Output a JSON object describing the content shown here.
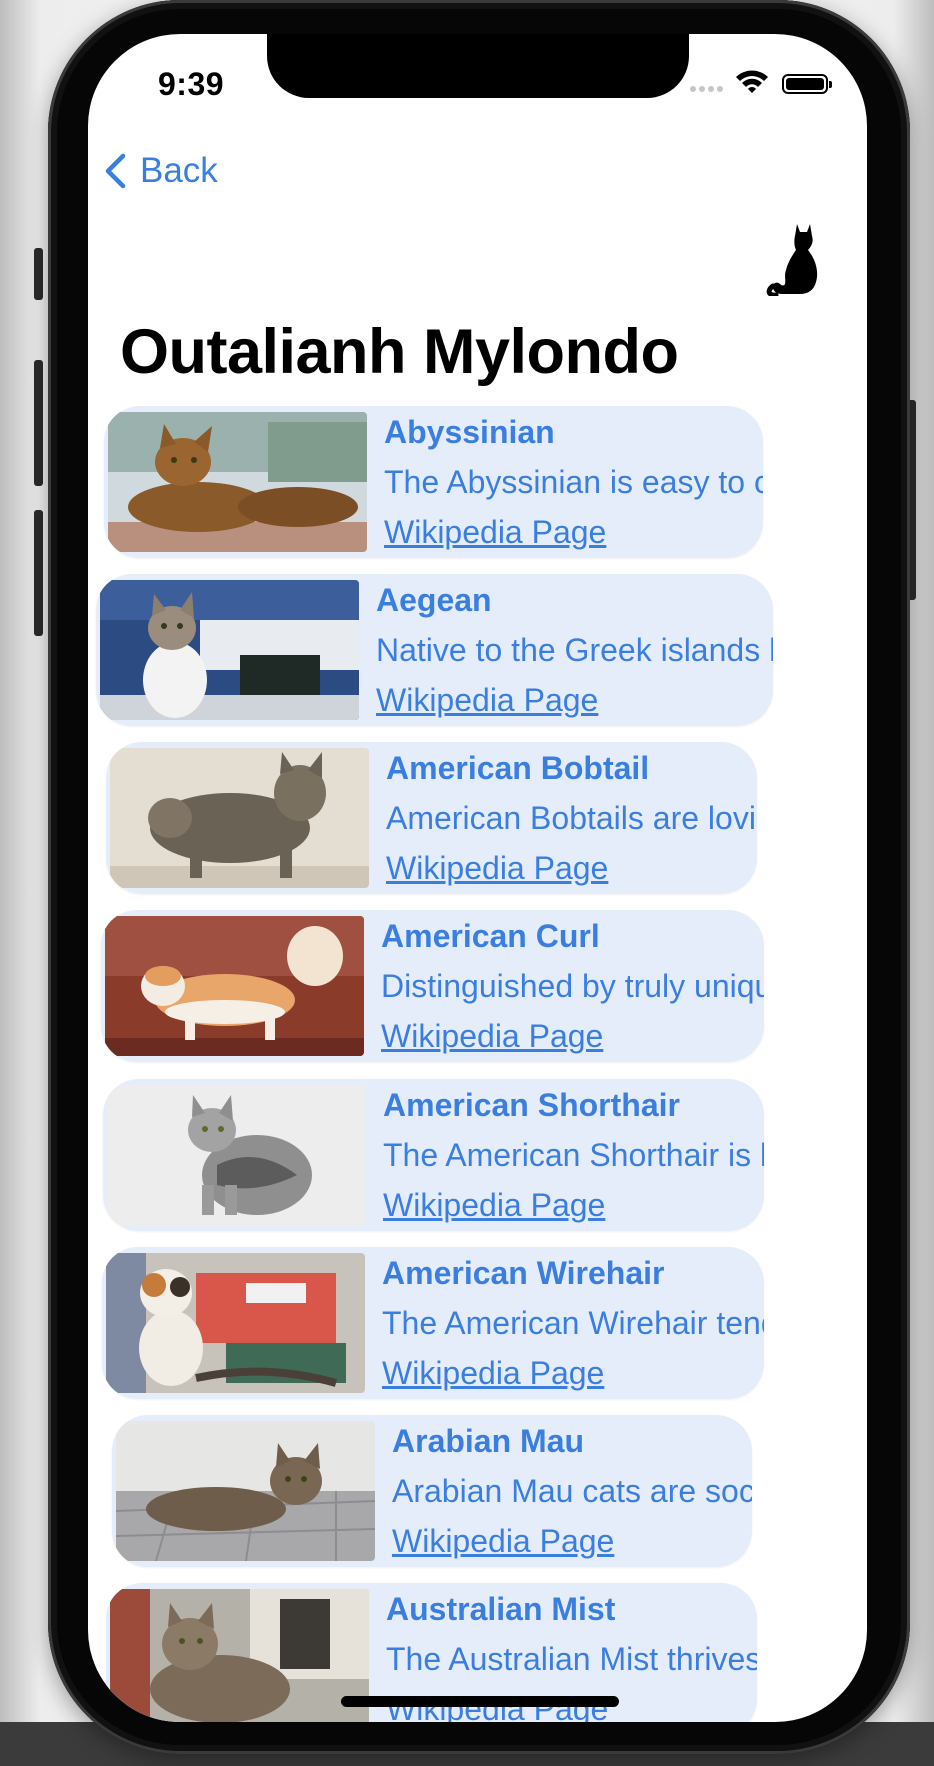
{
  "status_bar": {
    "time": "9:39"
  },
  "nav": {
    "back_label": "Back"
  },
  "page": {
    "title": "Outalianh Mylondo"
  },
  "accent_color": "#3a7ee0",
  "card_color": "#e6edfa",
  "breeds": [
    {
      "name": "Abyssinian",
      "description": "The Abyssinian is easy to car...",
      "link": "Wikipedia Page",
      "photo": "abyssinian cat lying on a ledge"
    },
    {
      "name": "Aegean",
      "description": "Native to the Greek islands kn...",
      "link": "Wikipedia Page",
      "photo": "white and tabby cat by the sea"
    },
    {
      "name": "American Bobtail",
      "description": "American Bobtails are loving...",
      "link": "Wikipedia Page",
      "photo": "tabby bobtail cat standing"
    },
    {
      "name": "American Curl",
      "description": "Distinguished by truly unique...",
      "link": "Wikipedia Page",
      "photo": "orange and white curl cat on red background"
    },
    {
      "name": "American Shorthair",
      "description": "The American Shorthair is kn...",
      "link": "Wikipedia Page",
      "photo": "silver tabby cat on white background"
    },
    {
      "name": "American Wirehair",
      "description": "The American Wirehair tends...",
      "link": "Wikipedia Page",
      "photo": "calico cat sitting"
    },
    {
      "name": "Arabian Mau",
      "description": "Arabian Mau cats are social...",
      "link": "Wikipedia Page",
      "photo": "tabby cat lying on pavement"
    },
    {
      "name": "Australian Mist",
      "description": "The Australian Mist thrives o...",
      "link": "Wikipedia Page",
      "photo": "tabby cat near brick wall"
    }
  ]
}
